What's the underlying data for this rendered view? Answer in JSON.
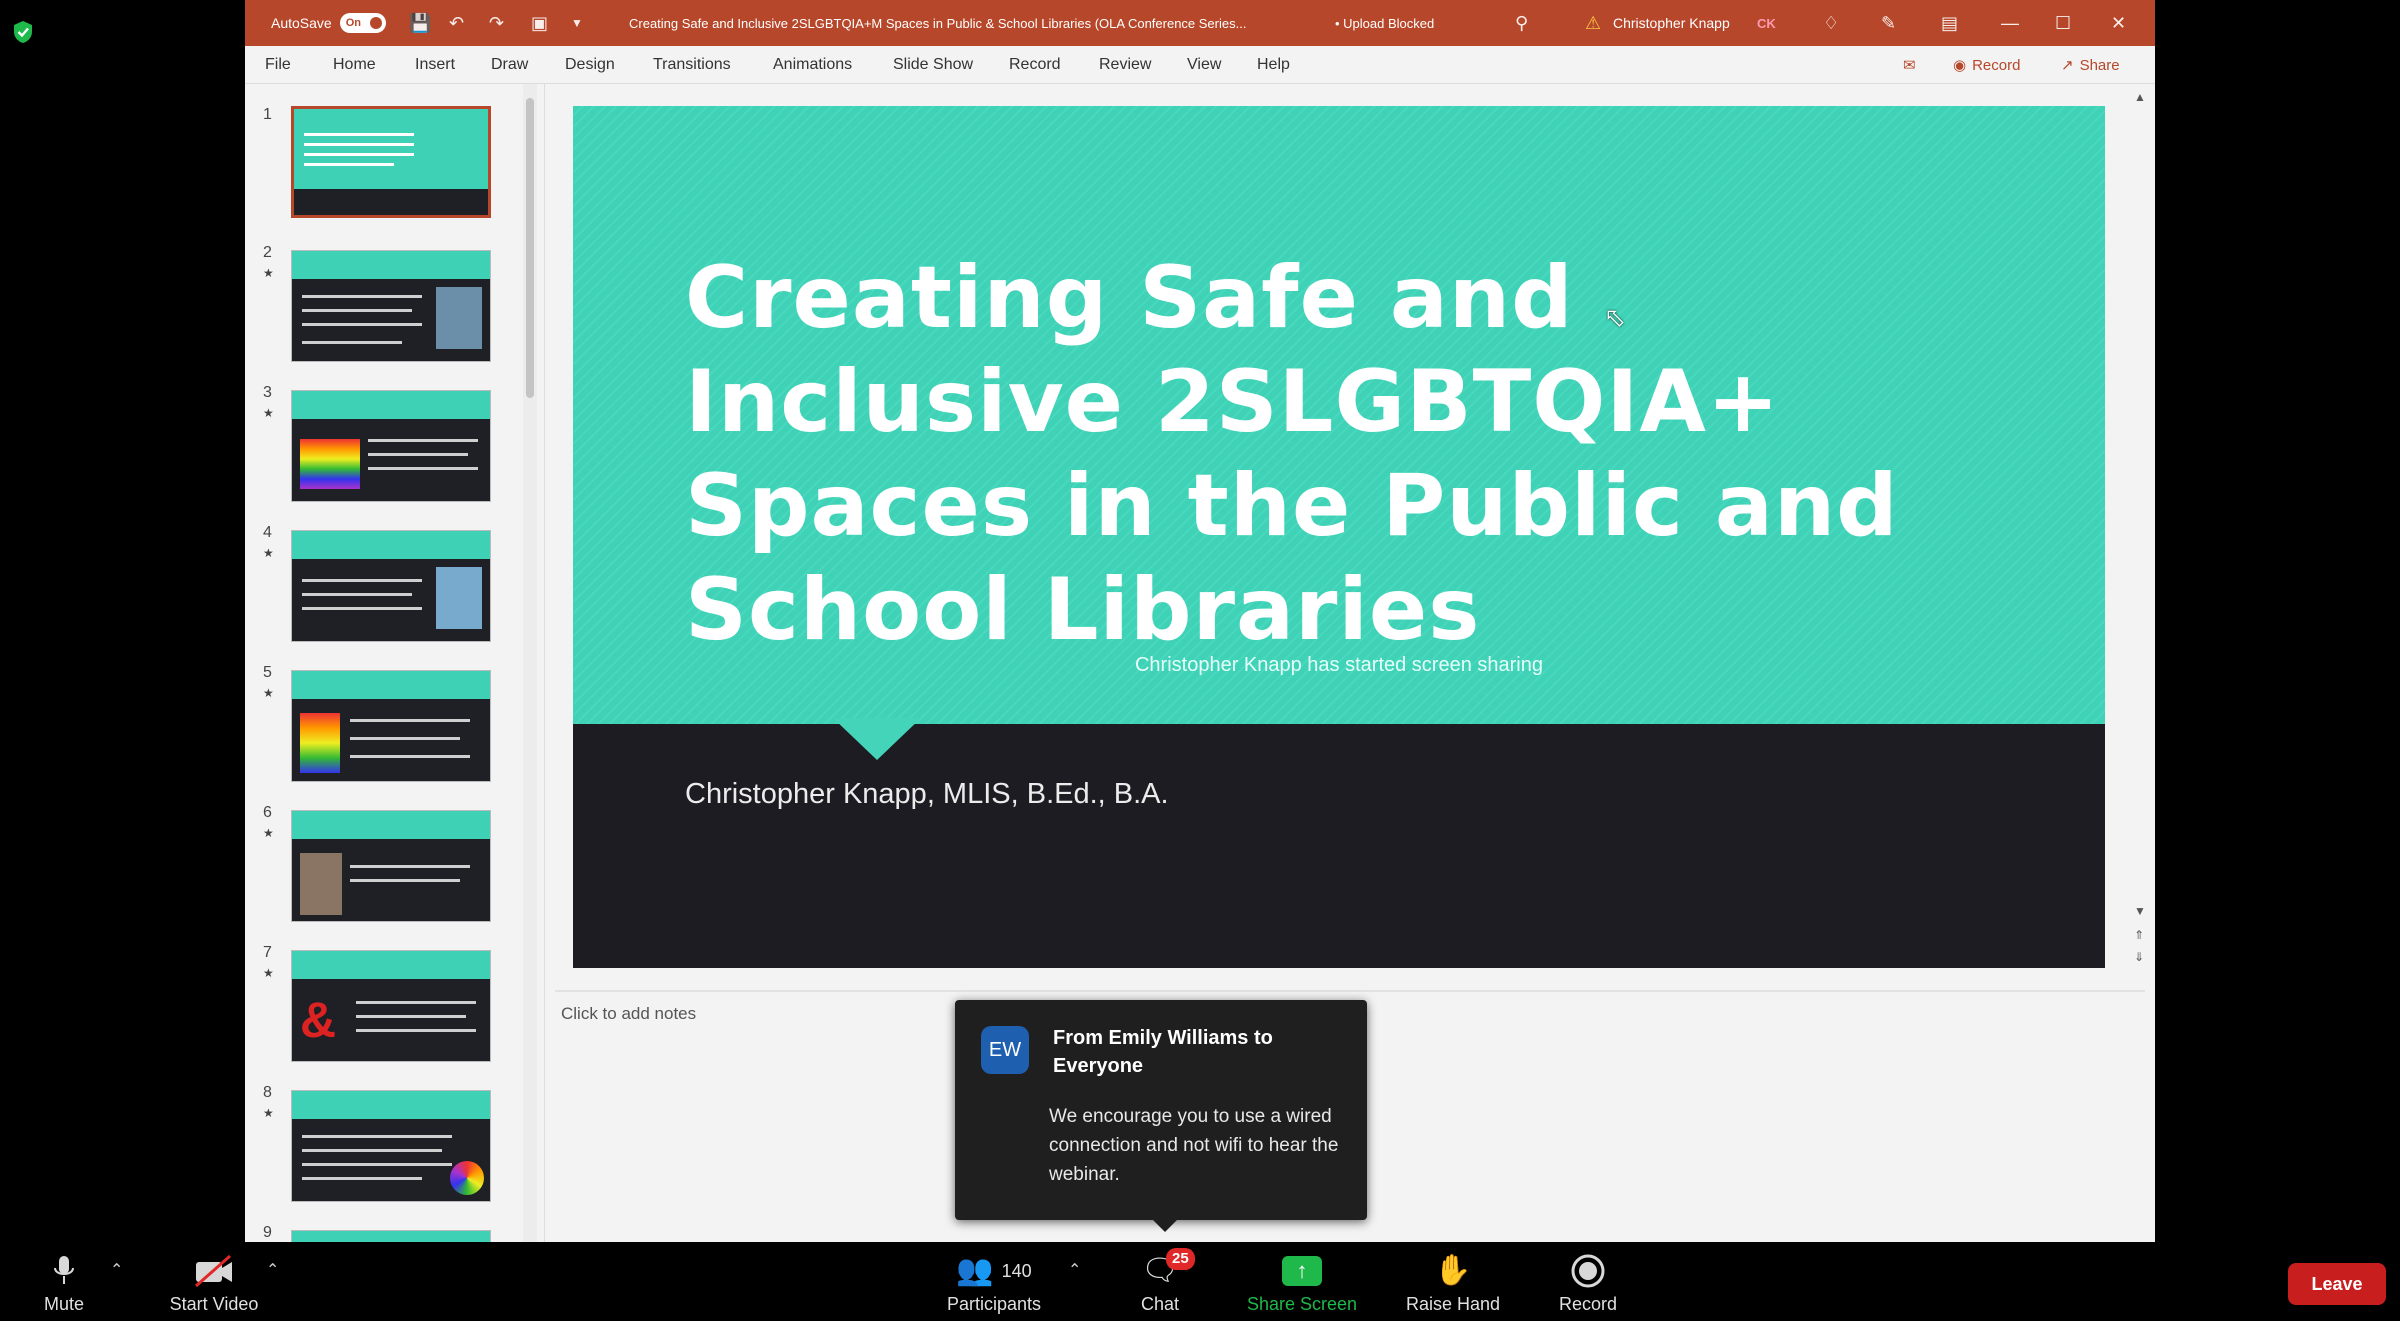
{
  "powerpoint": {
    "autosave_label": "AutoSave",
    "autosave_state": "On",
    "document_title": "Creating Safe and Inclusive 2SLGBTQIA+M Spaces in Public & School Libraries (OLA Conference Series...",
    "upload_status": "• Upload Blocked",
    "user_name": "Christopher Knapp",
    "user_initials": "CK",
    "menu": [
      "File",
      "Home",
      "Insert",
      "Draw",
      "Design",
      "Transitions",
      "Animations",
      "Slide Show",
      "Record",
      "Review",
      "View",
      "Help"
    ],
    "record_button": "Record",
    "share_button": "Share",
    "slide_numbers": [
      "1",
      "2",
      "3",
      "4",
      "5",
      "6",
      "7",
      "8",
      "9"
    ],
    "slide": {
      "title": "Creating Safe and Inclusive 2SLGBTQIA+ Spaces in the Public and School Libraries",
      "subtitle": "Christopher Knapp, MLIS, B.Ed., B.A."
    },
    "notes_placeholder": "Click to add notes"
  },
  "zoom": {
    "share_notice": "Christopher Knapp has started screen sharing",
    "chat_popup": {
      "avatar_initials": "EW",
      "from": "From Emily Williams to Everyone",
      "message": "We encourage you to use a wired connection and not wifi to hear the webinar."
    },
    "toolbar": {
      "mute": "Mute",
      "start_video": "Start Video",
      "participants": "Participants",
      "participants_count": "140",
      "chat": "Chat",
      "chat_badge": "25",
      "share_screen": "Share Screen",
      "raise_hand": "Raise Hand",
      "record": "Record",
      "leave": "Leave"
    },
    "colors": {
      "share_green": "#1fb84a",
      "leave_red": "#c81e1e",
      "badge_red": "#e02828"
    }
  },
  "theme": {
    "ppt_accent": "#b7472a",
    "slide_teal": "#40d2b6",
    "slide_dark": "#1c1c22"
  }
}
